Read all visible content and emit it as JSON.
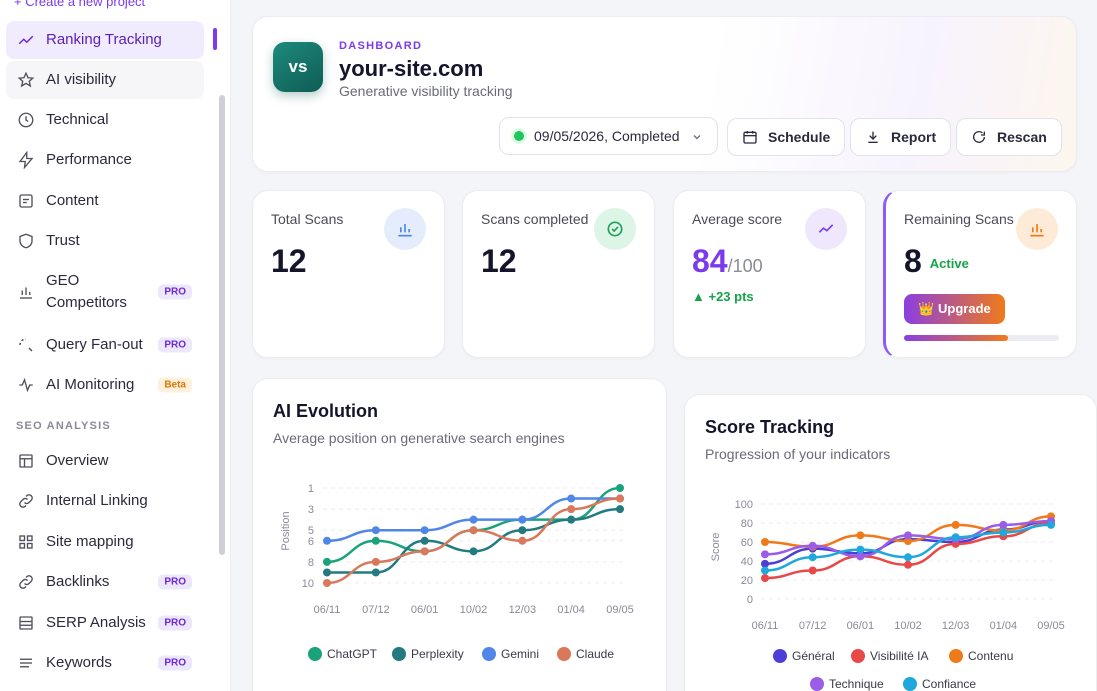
{
  "sidebar": {
    "create_link": "+ Create a new project",
    "items": [
      {
        "label": "Ranking Tracking",
        "icon": "trend-icon"
      },
      {
        "label": "AI visibility",
        "icon": "star-icon"
      },
      {
        "label": "Technical",
        "icon": "clock-icon"
      },
      {
        "label": "Performance",
        "icon": "bolt-icon"
      },
      {
        "label": "Content",
        "icon": "document-icon"
      },
      {
        "label": "Trust",
        "icon": "shield-icon"
      },
      {
        "label": "GEO Competitors",
        "icon": "bar-chart-icon",
        "badge": "PRO"
      },
      {
        "label": "Query Fan-out",
        "icon": "fan-out-icon",
        "badge": "PRO"
      },
      {
        "label": "AI Monitoring",
        "icon": "pulse-icon",
        "badge": "Beta"
      }
    ],
    "section_title": "SEO ANALYSIS",
    "seo_items": [
      {
        "label": "Overview",
        "icon": "layout-icon"
      },
      {
        "label": "Internal Linking",
        "icon": "link-icon"
      },
      {
        "label": "Site mapping",
        "icon": "sitemap-icon"
      },
      {
        "label": "Backlinks",
        "icon": "backlink-icon",
        "badge": "PRO"
      },
      {
        "label": "SERP Analysis",
        "icon": "serp-icon",
        "badge": "PRO"
      },
      {
        "label": "Keywords",
        "icon": "list-icon",
        "badge": "PRO"
      }
    ]
  },
  "header": {
    "logo_text": "vs",
    "eyebrow": "DASHBOARD",
    "title": "your-site.com",
    "subtitle": "Generative visibility tracking",
    "scan_select": "09/05/2026, Completed",
    "schedule": "Schedule",
    "report": "Report",
    "rescan": "Rescan"
  },
  "stats": {
    "total_scans": {
      "label": "Total Scans",
      "value": "12"
    },
    "scans_completed": {
      "label": "Scans completed",
      "value": "12"
    },
    "average_score": {
      "label": "Average score",
      "value": "84",
      "max": "/100",
      "delta": "▲ +23 pts"
    },
    "remaining_scans": {
      "label": "Remaining Scans",
      "value": "8",
      "status": "Active",
      "upgrade": "👑 Upgrade",
      "usage_fraction": 0.67
    }
  },
  "colors": {
    "accent": "#7c3aed",
    "chatgpt": "#1aa37a",
    "perplexity": "#237a80",
    "gemini": "#4f86e8",
    "claude": "#d9785a",
    "general": "#4b3fd6",
    "visibilite": "#e84848",
    "contenu": "#f07a1a",
    "technique": "#9b5ce8",
    "confiance": "#1fa8dc"
  },
  "ai_evolution": {
    "title": "AI Evolution",
    "subtitle": "Average position on generative search engines",
    "chart_data": {
      "type": "line",
      "ylabel": "Position",
      "y_ticks": [
        "1",
        "3",
        "5",
        "6",
        "8",
        "10"
      ],
      "categories": [
        "06/11",
        "07/12",
        "06/01",
        "10/02",
        "12/03",
        "01/04",
        "09/05"
      ],
      "y_reversed": true,
      "series": [
        {
          "name": "ChatGPT",
          "values": [
            8,
            6,
            7,
            5,
            4,
            4,
            1
          ],
          "color": "#1aa37a"
        },
        {
          "name": "Perplexity",
          "values": [
            9,
            9,
            6,
            7,
            5,
            4,
            3
          ],
          "color": "#237a80"
        },
        {
          "name": "Gemini",
          "values": [
            6,
            5,
            5,
            4,
            4,
            2,
            2
          ],
          "color": "#4f86e8"
        },
        {
          "name": "Claude",
          "values": [
            10,
            8,
            7,
            5,
            6,
            3,
            2
          ],
          "color": "#d9785a"
        }
      ]
    }
  },
  "score_tracking": {
    "title": "Score Tracking",
    "subtitle": "Progression of your indicators",
    "chart_data": {
      "type": "line",
      "ylabel": "Score",
      "ylim": [
        0,
        100
      ],
      "y_ticks": [
        "100",
        "80",
        "60",
        "40",
        "20",
        "0"
      ],
      "categories": [
        "06/11",
        "07/12",
        "06/01",
        "10/02",
        "12/03",
        "01/04",
        "09/05"
      ],
      "series": [
        {
          "name": "Général",
          "values": [
            37,
            53,
            48,
            63,
            60,
            73,
            82
          ],
          "color": "#4b3fd6"
        },
        {
          "name": "Visibilité IA",
          "values": [
            22,
            30,
            45,
            36,
            58,
            66,
            80
          ],
          "color": "#e84848"
        },
        {
          "name": "Contenu",
          "values": [
            60,
            55,
            67,
            61,
            78,
            72,
            87
          ],
          "color": "#f07a1a"
        },
        {
          "name": "Technique",
          "values": [
            47,
            56,
            45,
            67,
            63,
            78,
            82
          ],
          "color": "#9b5ce8"
        },
        {
          "name": "Confiance",
          "values": [
            30,
            44,
            52,
            44,
            65,
            70,
            78
          ],
          "color": "#1fa8dc"
        }
      ]
    }
  }
}
